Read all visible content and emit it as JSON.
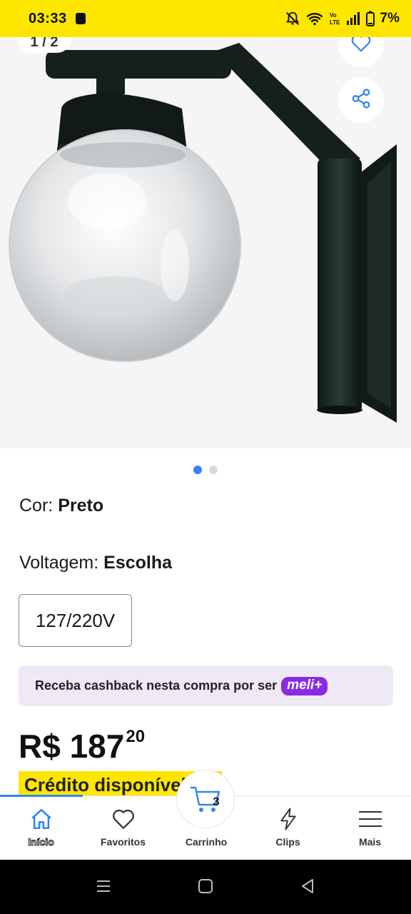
{
  "status_bar": {
    "time": "03:33",
    "battery_percent": "7%",
    "network_label": "Vo LTE"
  },
  "gallery": {
    "page_indicator": "1 / 2",
    "total_images": 2,
    "active_image": 1
  },
  "attributes": {
    "color_label": "Cor:",
    "color_value": "Preto",
    "voltage_label": "Voltagem:",
    "voltage_value": "Escolha",
    "voltage_option": "127/220V"
  },
  "cashback": {
    "text": "Receba cashback nesta compra por ser",
    "badge": "meli+"
  },
  "price": {
    "currency_and_integer": "R$ 187",
    "cents": "20"
  },
  "credit_banner": "Crédito disponível",
  "bottom_nav": {
    "items": [
      {
        "label": "Início",
        "icon": "home-icon"
      },
      {
        "label": "Favoritos",
        "icon": "heart-icon"
      },
      {
        "label": "Carrinho",
        "icon": "cart-icon"
      },
      {
        "label": "Clips",
        "icon": "lightning-icon"
      },
      {
        "label": "Mais",
        "icon": "menu-icon"
      }
    ],
    "cart_count": "3"
  },
  "colors": {
    "brand_yellow": "#ffe600",
    "accent_blue": "#3483fa",
    "meli_purple": "#8a2be2"
  }
}
